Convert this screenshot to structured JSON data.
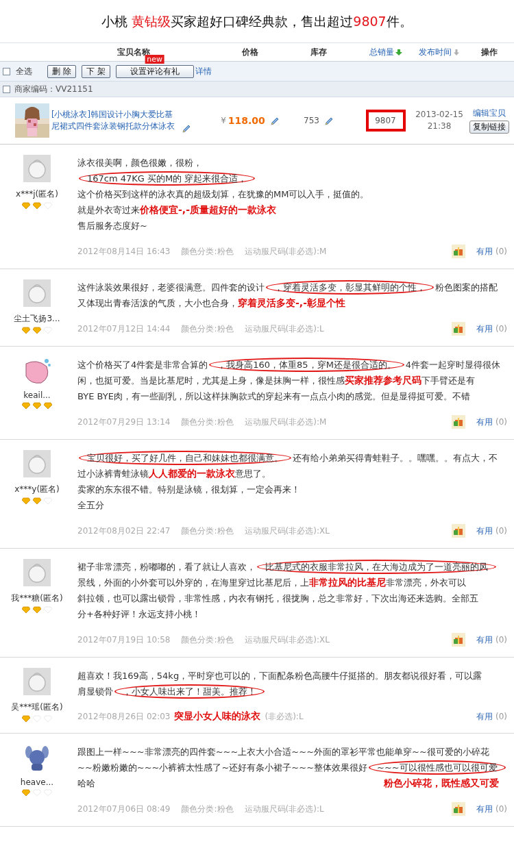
{
  "headline": "小桃 **黄钻级**买家超好口碑经典款，售出超过**9807**件。",
  "columns": [
    {
      "label": "宝贝名称",
      "sortable": false
    },
    {
      "label": "价格",
      "sortable": false
    },
    {
      "label": "库存",
      "sortable": false
    },
    {
      "label": "总销量",
      "sortable": true,
      "sorted": true
    },
    {
      "label": "发布时间",
      "sortable": true,
      "sorted": false
    },
    {
      "label": "操作",
      "sortable": false
    }
  ],
  "toolbar": {
    "select_all": {
      "label": "全选",
      "checked": false
    },
    "buttons": [
      {
        "label": "删 除"
      },
      {
        "label": "下 架"
      },
      {
        "label": "设置评论有礼",
        "badge": "new"
      }
    ],
    "link": "详情"
  },
  "merchant": {
    "label": "商家编码：VV21151",
    "checked": false
  },
  "product": {
    "title": "[小桃泳衣]韩国设计小胸大爱比基尼裙式四件套泳装钢托款分体泳衣",
    "currency": "¥",
    "price": "118.00",
    "stock": "753",
    "sales": "9807",
    "sales_highlighted": true,
    "date": "2013-02-15",
    "time": "21:38",
    "edit_link": "编辑宝贝",
    "copy_button": "复制链接"
  },
  "reviews": [
    {
      "user": "x***j(匿名)",
      "kind": "default",
      "stars": 2,
      "lines": [
        [
          {
            "text": "泳衣很美啊，颜色很嫩，很粉，",
            "kind": "plain"
          }
        ],
        [
          {
            "text": "167cm 47KG 买的M的 穿起来很合适，",
            "kind": "circled"
          }
        ],
        [
          {
            "text": "这个价格买到这样的泳衣真的超级划算，在犹豫的MM可以入手，挺值的。",
            "kind": "plain"
          }
        ],
        [
          {
            "text": "就是外衣寄过来",
            "kind": "plain"
          },
          {
            "text": "价格便宜-,-质量超好的一款泳衣",
            "kind": "caption"
          }
        ],
        [
          {
            "text": "售后服务态度好~",
            "kind": "plain"
          }
        ]
      ],
      "meta": [
        {
          "text": "2012年08月14日 16:43",
          "kind": "date"
        },
        {
          "text": "颜色分类:粉色",
          "kind": "info"
        },
        {
          "text": "运动服尺码(非必选):M",
          "kind": "info"
        }
      ],
      "gift": true,
      "useful": "有用",
      "count": "(0)"
    },
    {
      "user": "尘土飞扬3...",
      "kind": "default",
      "stars": 2,
      "lines": [
        [
          {
            "text": "这件泳装效果很好，老婆很满意。四件套的设计",
            "kind": "plain"
          },
          {
            "text": "，穿着灵活多变，彰显其鲜明的个性，",
            "kind": "circled"
          },
          {
            "text": "粉色图案的搭配",
            "kind": "plain"
          }
        ],
        [
          {
            "text": "又体现出青春活泼的气质，大小也合身，",
            "kind": "plain"
          },
          {
            "text": "穿着灵活多变-,-彰显个性",
            "kind": "caption"
          }
        ]
      ],
      "meta": [
        {
          "text": "2012年07月12日 14:44",
          "kind": "date"
        },
        {
          "text": "颜色分类:粉色",
          "kind": "info"
        },
        {
          "text": "运动服尺码(非必选):L",
          "kind": "info"
        }
      ],
      "gift": true,
      "useful": "有用",
      "count": "(0)"
    },
    {
      "user": "keail...",
      "kind": "pink",
      "stars": 3,
      "lines": [
        [
          {
            "text": "这个价格买了4件套是非常合算的",
            "kind": "plain"
          },
          {
            "text": "，我身高160，体重85，穿M还是很合适的。",
            "kind": "circled"
          },
          {
            "text": "4件套一起穿时显得很休",
            "kind": "plain"
          }
        ],
        [
          {
            "text": "闲，也挺可爱。当是比基尼时，尤其是上身，像是抹胸一样，很性感",
            "kind": "plain"
          },
          {
            "text": "买家推荐参考尺码",
            "kind": "caption"
          },
          {
            "text": "下手臂还是有",
            "kind": "plain"
          }
        ],
        [
          {
            "text": "BYE BYE肉，有一些副乳，所以这样抹胸款式的穿起来有一点点小肉的感觉。但是显得挺可爱。不错",
            "kind": "plain"
          }
        ]
      ],
      "meta": [
        {
          "text": "2012年07月29日 13:14",
          "kind": "date"
        },
        {
          "text": "颜色分类:粉色",
          "kind": "info"
        },
        {
          "text": "运动服尺码(非必选):M",
          "kind": "info"
        }
      ],
      "gift": true,
      "useful": "有用",
      "count": "(0)"
    },
    {
      "user": "x***y(匿名)",
      "kind": "default",
      "stars": 2,
      "lines": [
        [
          {
            "text": "宝贝很好，买了好几件，自己和妹妹也都很满意。",
            "kind": "circled"
          },
          {
            "text": "还有给小弟弟买得青蛙鞋子。。嘿嘿。。有点大，不",
            "kind": "plain"
          }
        ],
        [
          {
            "text": "过小泳裤青蛙泳镜",
            "kind": "plain"
          },
          {
            "text": "人人都爱的一款泳衣",
            "kind": "caption"
          },
          {
            "text": "意思了。",
            "kind": "plain"
          }
        ],
        [
          {
            "text": "卖家的东东很不错。特别是泳镜，很划算，一定会再来！",
            "kind": "plain"
          }
        ],
        [
          {
            "text": "全五分",
            "kind": "plain"
          }
        ]
      ],
      "meta": [
        {
          "text": "2012年08月02日 22:47",
          "kind": "date"
        },
        {
          "text": "颜色分类:粉色",
          "kind": "info"
        },
        {
          "text": "运动服尺码(非必选):XL",
          "kind": "info"
        }
      ],
      "gift": true,
      "useful": "有用",
      "count": "(0)"
    },
    {
      "user": "我***糖(匿名)",
      "kind": "default",
      "stars": 2,
      "lines": [
        [
          {
            "text": "裙子非常漂亮，粉嘟嘟的，看了就让人喜欢，",
            "kind": "plain"
          },
          {
            "text": "比基尼式的衣服非常拉风，在大海边成为了一道亮丽的风",
            "kind": "circled"
          }
        ],
        [
          {
            "text": "景线，外面的小外套可以外穿的，在海里穿过比基尼后，上",
            "kind": "plain"
          },
          {
            "text": "非常拉风的比基尼",
            "kind": "caption"
          },
          {
            "text": "非常漂亮，外衣可以",
            "kind": "plain"
          }
        ],
        [
          {
            "text": "斜拉领，也可以露出锁骨，非常性感，内衣有钢托，很拢胸，总之非常好，下次出海还来选购。全部五",
            "kind": "plain"
          }
        ],
        [
          {
            "text": "分+各种好评！永远支持小桃！",
            "kind": "plain"
          }
        ]
      ],
      "meta": [
        {
          "text": "2012年07月19日 10:58",
          "kind": "date"
        },
        {
          "text": "颜色分类:粉色",
          "kind": "info"
        },
        {
          "text": "运动服尺码(非必选):XL",
          "kind": "info"
        }
      ],
      "gift": true,
      "useful": "有用",
      "count": "(0)"
    },
    {
      "user": "吴***瑶(匿名)",
      "kind": "default",
      "stars": 1,
      "lines": [
        [
          {
            "text": "超喜欢！我169高，54kg，平时穿也可以的，下面配条粉色高腰牛仔挺搭的。朋友都说很好看，可以露",
            "kind": "plain"
          }
        ],
        [
          {
            "text": "肩显锁骨",
            "kind": "plain"
          },
          {
            "text": "，小女人味出来了！甜美。推荐！",
            "kind": "circled"
          }
        ]
      ],
      "meta": [
        {
          "text": "2012年08月26日 02:03",
          "kind": "date"
        },
        {
          "text": "突显小女人味的泳衣",
          "kind": "caption"
        },
        {
          "text": "(非必选):L",
          "kind": "info"
        }
      ],
      "gift": false,
      "useful": "有用",
      "count": "(0)"
    },
    {
      "user": "heave...",
      "kind": "blue",
      "stars": 1,
      "lines": [
        [
          {
            "text": "跟图上一样~~~非常漂亮的四件套~~~上衣大小合适~~~外面的罩衫平常也能单穿~~很可爱的小碎花",
            "kind": "plain"
          }
        ],
        [
          {
            "text": "~~粉嫩粉嫩的~~~小裤裤太性感了~还好有条小裙子~~~整体效果很好",
            "kind": "plain"
          },
          {
            "text": "~~~可以很性感也可以很可爱",
            "kind": "circled"
          }
        ],
        [
          {
            "text": "哈哈",
            "kind": "plain"
          },
          {
            "text": "粉色小碎花，既性感又可爱",
            "kind": "caption-right"
          }
        ]
      ],
      "meta": [
        {
          "text": "2012年07月06日 08:49",
          "kind": "date"
        },
        {
          "text": "颜色分类:粉色",
          "kind": "info"
        },
        {
          "text": "运动服尺码(非必选):L",
          "kind": "info"
        }
      ],
      "gift": true,
      "useful": "有用",
      "count": "(0)"
    }
  ]
}
